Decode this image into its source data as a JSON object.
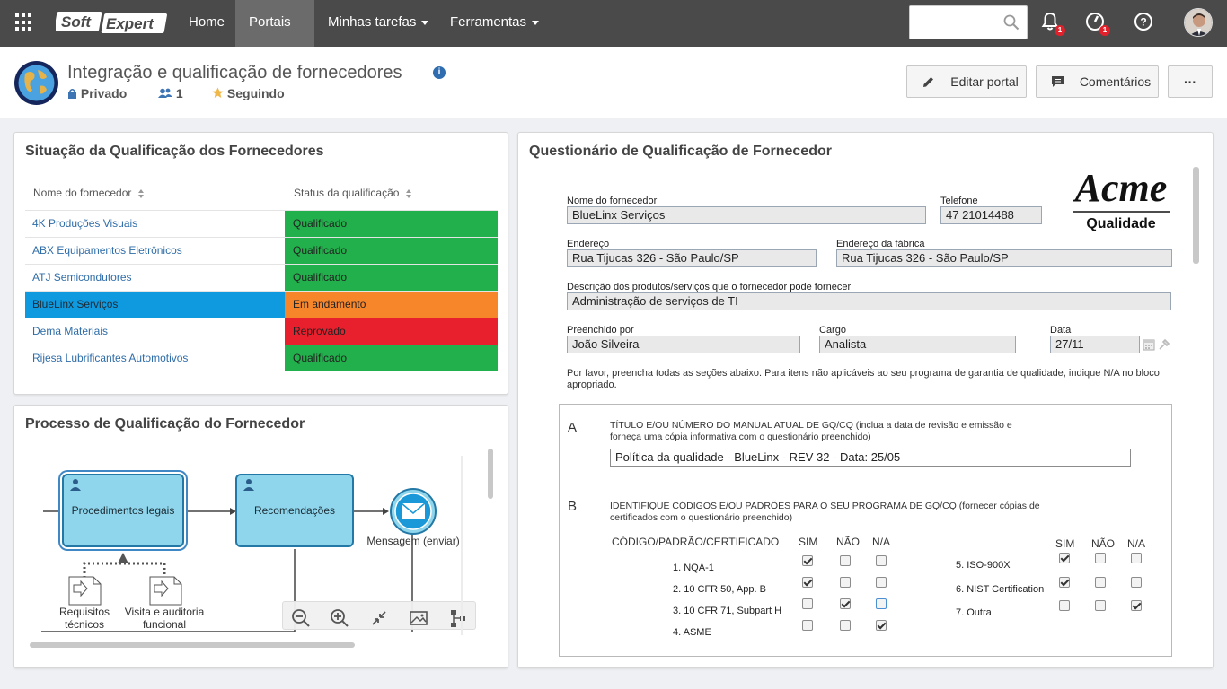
{
  "topbar": {
    "logo_text": "SoftExpert",
    "nav": [
      {
        "label": "Home",
        "dropdown": false,
        "active": false
      },
      {
        "label": "Portais",
        "dropdown": true,
        "active": true
      },
      {
        "label": "Minhas tarefas",
        "dropdown": true,
        "active": false
      },
      {
        "label": "Ferramentas",
        "dropdown": true,
        "active": false
      }
    ],
    "search": {
      "value": "",
      "placeholder": ""
    },
    "notifications_badge": "1",
    "activity_badge": "1"
  },
  "portal": {
    "title": "Integração e qualificação de fornecedores",
    "visibility": "Privado",
    "members_count": "1",
    "following": "Seguindo",
    "edit_button": "Editar portal",
    "comments_button": "Comentários",
    "more_button": "···"
  },
  "supplier_status": {
    "title": "Situação da Qualificação dos Fornecedores",
    "columns": [
      "Nome do fornecedor",
      "Status da qualificação"
    ],
    "rows": [
      {
        "name": "4K Produções Visuais",
        "status": "Qualificado",
        "color": "#21b04b"
      },
      {
        "name": "ABX Equipamentos Eletrônicos",
        "status": "Qualificado",
        "color": "#21b04b"
      },
      {
        "name": "ATJ Semicondutores",
        "status": "Qualificado",
        "color": "#21b04b"
      },
      {
        "name": "BlueLinx Serviços",
        "status": "Em andamento",
        "color": "#f7862b"
      },
      {
        "name": "Dema Materiais",
        "status": "Reprovado",
        "color": "#e8202e"
      },
      {
        "name": "Rijesa Lubrificantes Automotivos",
        "status": "Qualificado",
        "color": "#21b04b"
      }
    ]
  },
  "process": {
    "title": "Processo de Qualificação do Fornecedor",
    "tasks": [
      "Procedimentos legais",
      "Recomendações"
    ],
    "message_event": "Mensagem (enviar)",
    "documents": [
      "Requisitos técnicos",
      "Visita e auditoria funcional"
    ]
  },
  "questionnaire": {
    "title": "Questionário de Qualificação de Fornecedor",
    "logo": {
      "brand": "Acme",
      "subtitle": "Qualidade"
    },
    "fields": {
      "supplier_name": {
        "label": "Nome do fornecedor",
        "value": "BlueLinx Serviços"
      },
      "phone": {
        "label": "Telefone",
        "value": "47 21014488"
      },
      "address": {
        "label": "Endereço",
        "value": "Rua Tijucas 326 - São Paulo/SP"
      },
      "factory_address": {
        "label": "Endereço da fábrica",
        "value": "Rua Tijucas 326 - São Paulo/SP"
      },
      "products": {
        "label": "Descrição dos produtos/serviços que o fornecedor pode fornecer",
        "value": "Administração de serviços de TI"
      },
      "filled_by": {
        "label": "Preenchido por",
        "value": "João Silveira"
      },
      "role": {
        "label": "Cargo",
        "value": "Analista"
      },
      "date": {
        "label": "Data",
        "value": "27/11"
      }
    },
    "note": "Por favor, preencha todas as seções abaixo. Para itens não aplicáveis ao seu programa de garantia de qualidade, indique N/A no bloco apropriado.",
    "section_a": {
      "letter": "A",
      "text": "TÍTULO E/OU NÚMERO DO MANUAL ATUAL DE GQ/CQ (inclua a data de revisão e emissão e forneça uma cópia informativa com o questionário preenchido)",
      "value": "Política da qualidade - BlueLinx - REV 32 - Data: 25/05"
    },
    "section_b": {
      "letter": "B",
      "text": "IDENTIFIQUE CÓDIGOS E/OU PADRÕES PARA O SEU PROGRAMA DE GQ/CQ (fornecer cópias de certificados com o questionário preenchido)",
      "col_header": "CÓDIGO/PADRÃO/CERTIFICADO",
      "options": [
        "SIM",
        "NÃO",
        "N/A"
      ],
      "left_items": [
        {
          "label": "1. NQA-1",
          "checked": "SIM"
        },
        {
          "label": "2. 10 CFR 50, App. B",
          "checked": "SIM"
        },
        {
          "label": "3. 10 CFR 71, Subpart H",
          "checked": "NÃO"
        },
        {
          "label": "4. ASME",
          "checked": "N/A"
        }
      ],
      "right_items": [
        {
          "label": "5. ISO-900X",
          "checked": "SIM"
        },
        {
          "label": "6. NIST Certification",
          "checked": "SIM"
        },
        {
          "label": "7. Outra",
          "checked": "N/A"
        }
      ]
    }
  }
}
